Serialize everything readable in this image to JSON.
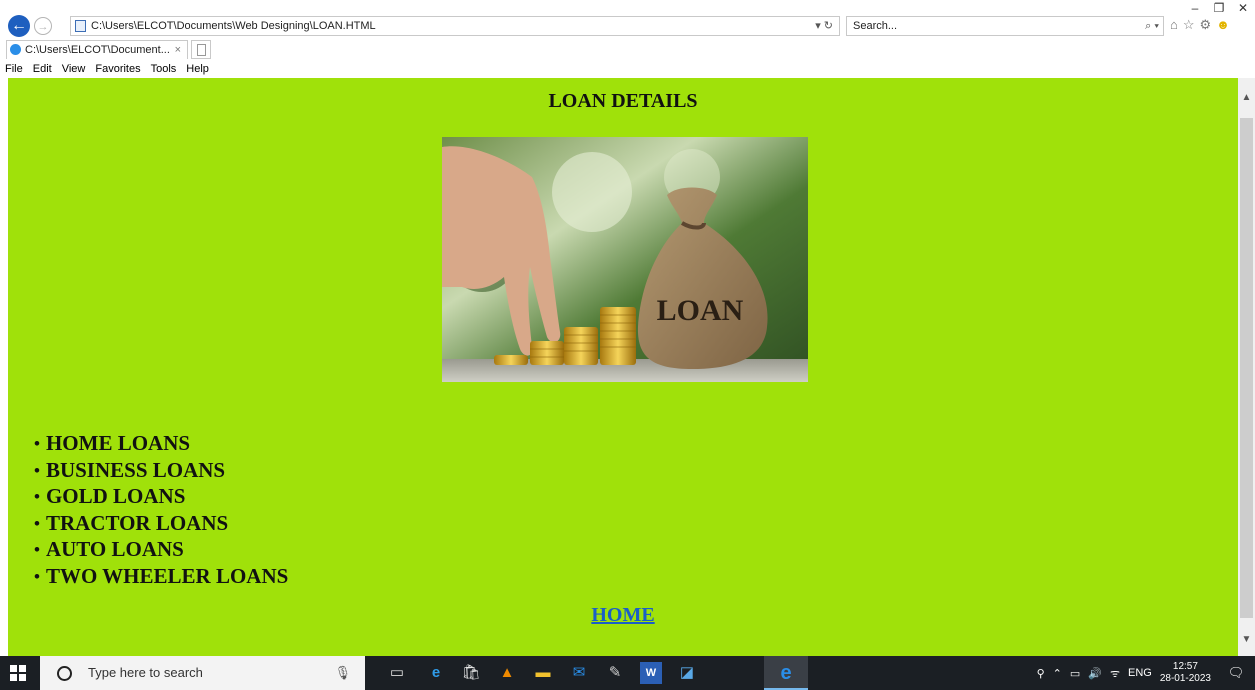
{
  "window": {
    "minimize_icon": "minimize-icon",
    "maximize_icon": "restore-icon",
    "close_icon": "close-icon",
    "minimize": "–",
    "maximize": "❐",
    "close": "✕"
  },
  "address_bar": {
    "url": "C:\\Users\\ELCOT\\Documents\\Web Designing\\LOAN.HTML",
    "refresh_icon": "refresh-icon",
    "search_placeholder": "Search...",
    "search_icon": "search-icon"
  },
  "tab": {
    "title": "C:\\Users\\ELCOT\\Document...",
    "close": "×"
  },
  "menu": [
    "File",
    "Edit",
    "View",
    "Favorites",
    "Tools",
    "Help"
  ],
  "page": {
    "heading": "LOAN DETAILS",
    "image_text": "LOAN",
    "loans": [
      "HOME LOANS",
      "BUSINESS LOANS",
      "GOLD LOANS",
      "TRACTOR LOANS",
      "AUTO LOANS",
      "TWO WHEELER LOANS"
    ],
    "home_link": "HOME"
  },
  "taskbar": {
    "search_placeholder": "Type here to search",
    "language": "ENG",
    "time": "12:57",
    "date": "28-01-2023"
  },
  "colors": {
    "page_background": "#a0e10a",
    "link": "#1a5fc7",
    "taskbar": "#1b1f24"
  }
}
